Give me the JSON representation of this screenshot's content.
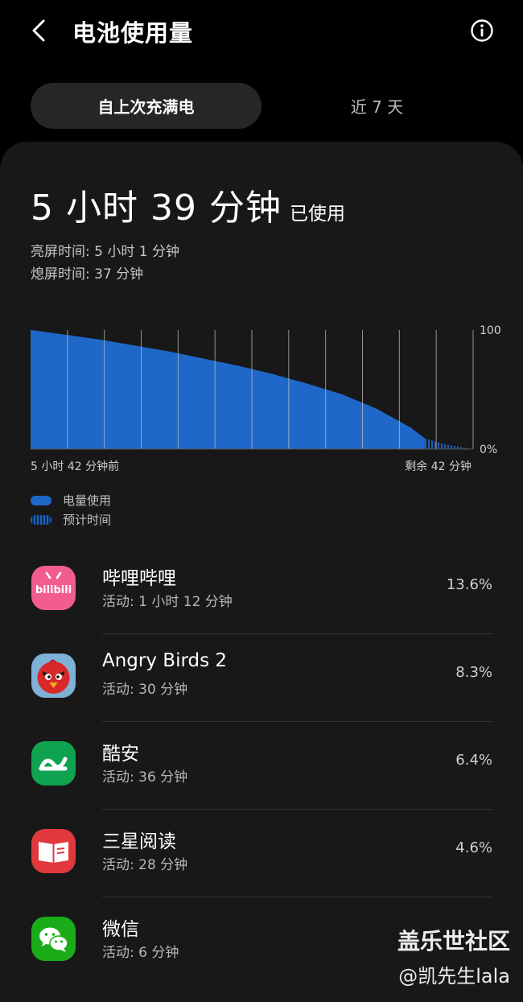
{
  "header": {
    "title": "电池使用量",
    "back_icon": "back-arrow-icon",
    "info_icon": "info-icon"
  },
  "tabs": [
    {
      "label": "自上次充满电",
      "active": true
    },
    {
      "label": "近 7 天",
      "active": false
    }
  ],
  "usage": {
    "total": "5 小时 39 分钟",
    "total_suffix": "已使用",
    "screen_on": "亮屏时间:  5 小时 1 分钟",
    "screen_off": "熄屏时间:  37 分钟"
  },
  "chart_data": {
    "type": "area",
    "x": [
      0,
      30,
      60,
      90,
      120,
      150,
      180,
      210,
      240,
      270,
      300,
      330,
      342,
      360,
      384
    ],
    "series": [
      {
        "name": "电量使用",
        "values": [
          100,
          96,
          92,
          87,
          82,
          76,
          70,
          63,
          55,
          46,
          34,
          18,
          9,
          null,
          null
        ]
      },
      {
        "name": "预计时间",
        "values": [
          null,
          null,
          null,
          null,
          null,
          null,
          null,
          null,
          null,
          null,
          null,
          null,
          9,
          4,
          0
        ]
      }
    ],
    "xlabel": "",
    "ylabel": "",
    "ylim": [
      0,
      100
    ],
    "y_tick_labels": [
      "100",
      "0%"
    ],
    "range_start_label": "5 小时 42 分钟前",
    "range_end_label": "剩余 42 分钟",
    "grid": true,
    "colors": {
      "used": "#1f68c9",
      "predicted": "#1f5fb8"
    }
  },
  "legend": [
    {
      "label": "电量使用",
      "style": "solid"
    },
    {
      "label": "预计时间",
      "style": "dashed"
    }
  ],
  "apps": [
    {
      "name": "哔哩哔哩",
      "activity": "活动: 1 小时 12 分钟",
      "percent": "13.6%",
      "icon": "bilibili-icon",
      "icon_text": "bilibili",
      "color": "#f25d8e"
    },
    {
      "name": "Angry Birds 2",
      "activity": "活动: 30 分钟",
      "percent": "8.3%",
      "icon": "angry-birds-icon",
      "color": "#d8282a"
    },
    {
      "name": "酷安",
      "activity": "活动: 36 分钟",
      "percent": "6.4%",
      "icon": "coolapk-icon",
      "color": "#10a34f"
    },
    {
      "name": "三星阅读",
      "activity": "活动: 28 分钟",
      "percent": "4.6%",
      "icon": "samsung-reader-icon",
      "color": "#e0383c"
    },
    {
      "name": "微信",
      "activity": "活动: 6 分钟",
      "percent": "",
      "icon": "wechat-icon",
      "color": "#1aad19"
    }
  ],
  "watermark": {
    "line1": "盖乐世社区",
    "line2": "@凯先生lala"
  }
}
